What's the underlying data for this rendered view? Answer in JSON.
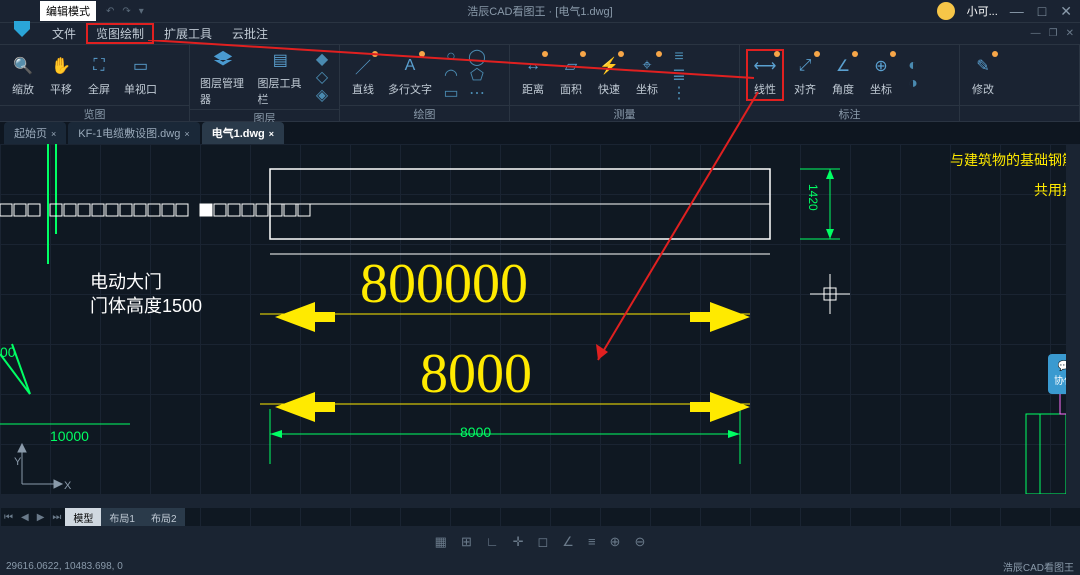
{
  "titlebar": {
    "mode": "编辑模式",
    "center": "浩辰CAD看图王 · [电气1.dwg]",
    "user": "小可..."
  },
  "menubar": {
    "items": [
      "文件",
      "览图绘制",
      "扩展工具",
      "云批注"
    ]
  },
  "ribbon": {
    "groups": [
      {
        "label": "览图",
        "tools": [
          {
            "name": "zoom",
            "label": "缩放"
          },
          {
            "name": "pan",
            "label": "平移"
          },
          {
            "name": "fullscreen",
            "label": "全屏"
          },
          {
            "name": "viewport",
            "label": "单视口"
          }
        ]
      },
      {
        "label": "图层",
        "tools": [
          {
            "name": "layer-manager",
            "label": "图层管理器"
          },
          {
            "name": "layer-toolbar",
            "label": "图层工具栏"
          }
        ]
      },
      {
        "label": "绘图",
        "tools": [
          {
            "name": "line",
            "label": "直线"
          },
          {
            "name": "mtext",
            "label": "多行文字"
          }
        ]
      },
      {
        "label": "测量",
        "tools": [
          {
            "name": "distance",
            "label": "距离"
          },
          {
            "name": "area",
            "label": "面积"
          },
          {
            "name": "quick",
            "label": "快速"
          },
          {
            "name": "coord-m",
            "label": "坐标"
          }
        ]
      },
      {
        "label": "标注",
        "tools": [
          {
            "name": "linear",
            "label": "线性"
          },
          {
            "name": "aligned",
            "label": "对齐"
          },
          {
            "name": "angle",
            "label": "角度"
          },
          {
            "name": "coord-a",
            "label": "坐标"
          }
        ]
      }
    ],
    "modify": "修改"
  },
  "tabs": {
    "items": [
      {
        "name": "home",
        "label": "起始页"
      },
      {
        "name": "kf1",
        "label": "KF-1电缆敷设图.dwg"
      },
      {
        "name": "elec1",
        "label": "电气1.dwg",
        "active": true
      }
    ]
  },
  "viewport": {
    "text_door": "电动大门",
    "text_height": "门体高度1500",
    "dim_10000": "10000",
    "dim_8000_small": "8000",
    "dim_800000": "800000",
    "dim_8000_big": "8000",
    "dim_1420": "1420",
    "dim_00": "00",
    "note1": "与建筑物的基础钢筋",
    "note2": "共用接",
    "axis_y": "Y",
    "axis_x": "X",
    "layout_tabs": {
      "model": "模型",
      "layout1": "布局1",
      "layout2": "布局2"
    },
    "coop": "协作"
  },
  "statusbar": {
    "coords": "29616.0622, 10483.698, 0",
    "app": "浩辰CAD看图王"
  }
}
